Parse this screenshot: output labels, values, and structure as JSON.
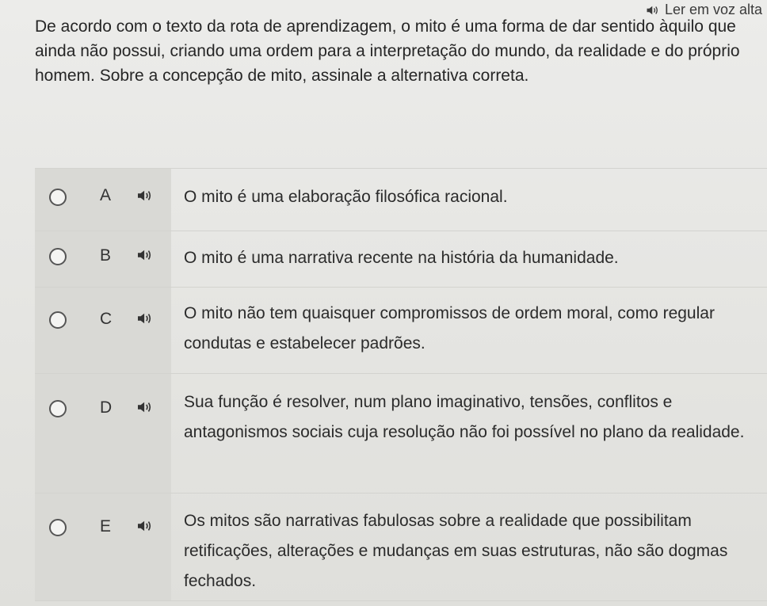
{
  "read_aloud": {
    "label": "Ler em voz alta",
    "icon": "speaker-icon"
  },
  "question": {
    "text": "De acordo com o texto da rota de aprendizagem, o mito é uma forma de dar sentido àquilo que ainda não possui, criando uma ordem para a interpretação do mundo, da realidade e do próprio homem. Sobre a concepção de mito, assinale a alternativa correta."
  },
  "options": [
    {
      "letter": "A",
      "text": "O mito é uma elaboração filosófica racional."
    },
    {
      "letter": "B",
      "text": "O mito é uma narrativa recente na história da humanidade."
    },
    {
      "letter": "C",
      "text": "O mito não tem quaisquer compromissos de ordem moral, como regular condutas e estabelecer padrões."
    },
    {
      "letter": "D",
      "text": "Sua função é resolver, num plano imaginativo, tensões, conflitos e antagonismos sociais cuja resolução não foi possível no plano da realidade."
    },
    {
      "letter": "E",
      "text": "Os mitos são narrativas fabulosas sobre a realidade que possibilitam retificações, alterações e mudanças em suas estruturas, não são dogmas fechados."
    }
  ],
  "colors": {
    "background": "#e6e6e3",
    "text": "#2a2a2a",
    "option_left_panel": "#d9d9d5"
  }
}
